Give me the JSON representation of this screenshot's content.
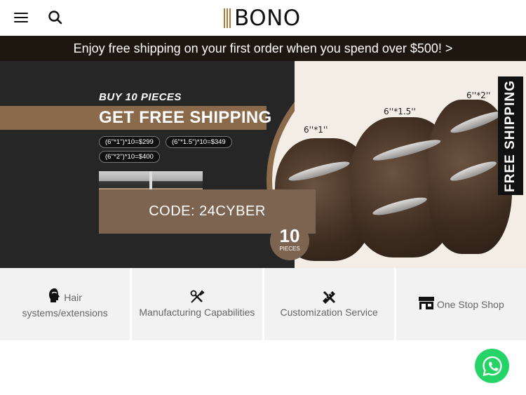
{
  "header": {
    "logo_text": "BONO",
    "menu_icon": "hamburger-menu-icon",
    "search_icon": "search-icon"
  },
  "announcement": {
    "text": "Enjoy free shipping on your first order when you spend over $500! >"
  },
  "hero": {
    "buy_text": "BUY 10 PIECES",
    "headline": "GET FREE SHIPPING",
    "prices": [
      "(6''*1'')*10=$299",
      "(6''*1.5'')*10=$349",
      "(6''*2'')*10=$400"
    ],
    "code_label": "CODE: 24CYBER",
    "badge_number": "10",
    "badge_label": "PIECES",
    "sizes": [
      "6''*1''",
      "6''*1.5''",
      "6''*2''"
    ],
    "side_tag": "FREE SHIPPING",
    "accent_color": "#7d6450"
  },
  "categories": [
    {
      "label": "Hair systems/extensions",
      "icon": "hair-head-icon"
    },
    {
      "label": "Manufacturing Capabilities",
      "icon": "tools-icon"
    },
    {
      "label": "Customization Service",
      "icon": "ruler-pencil-icon"
    },
    {
      "label": "One Stop Shop",
      "icon": "store-icon"
    }
  ],
  "chat": {
    "icon": "whatsapp-icon",
    "color": "#25d366"
  }
}
